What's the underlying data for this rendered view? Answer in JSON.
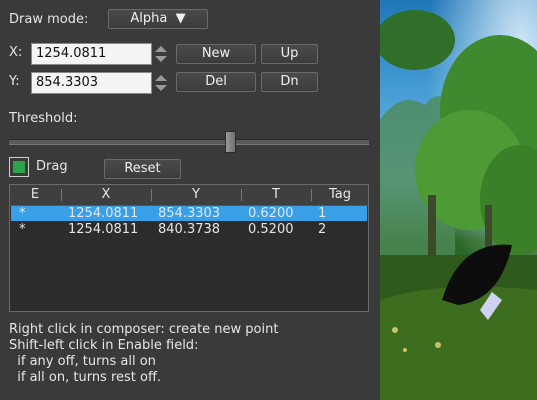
{
  "draw_mode": {
    "label": "Draw mode:",
    "value": "Alpha"
  },
  "x_field": {
    "label": "X:",
    "value": "1254.0811"
  },
  "y_field": {
    "label": "Y:",
    "value": "854.3303"
  },
  "buttons": {
    "new": "New",
    "up": "Up",
    "del": "Del",
    "dn": "Dn",
    "reset": "Reset"
  },
  "threshold": {
    "label": "Threshold:",
    "level": 0.61
  },
  "drag": {
    "label": "Drag",
    "checked": true
  },
  "table": {
    "columns": [
      "E",
      "X",
      "Y",
      "T",
      "Tag"
    ],
    "rows": [
      {
        "e": "*",
        "x": "1254.0811",
        "y": "854.3303",
        "t": "0.6200",
        "tag": "1",
        "selected": true
      },
      {
        "e": "*",
        "x": "1254.0811",
        "y": "840.3738",
        "t": "0.5200",
        "tag": "2",
        "selected": false
      }
    ]
  },
  "help": [
    "Right click in composer: create new point",
    "Shift-left click in Enable field:",
    "  if any off, turns all on",
    "  if all on, turns rest off."
  ],
  "colors": {
    "panel": "#3a3a3a",
    "selection": "#39a0e8",
    "check": "#2fa34a"
  }
}
